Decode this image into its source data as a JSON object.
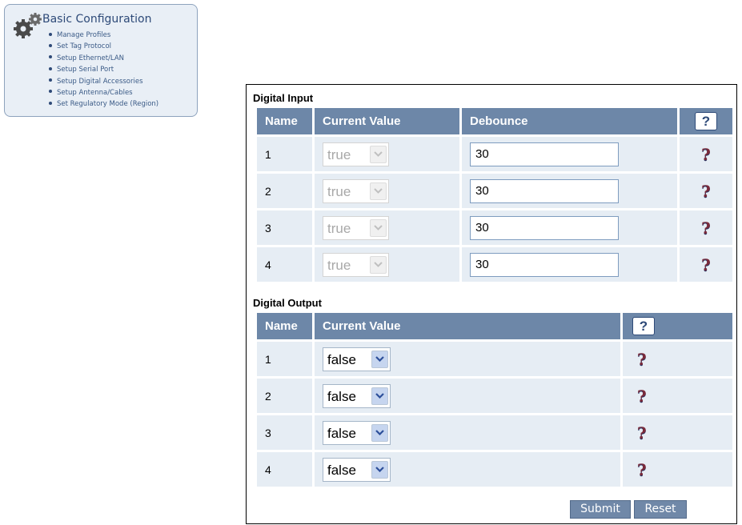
{
  "nav": {
    "title": "Basic Configuration",
    "items": [
      "Manage Profiles",
      "Set Tag Protocol",
      "Setup Ethernet/LAN",
      "Setup Serial Port",
      "Setup Digital Accessories",
      "Setup Antenna/Cables",
      "Set Regulatory Mode (Region)"
    ]
  },
  "digital_input": {
    "title": "Digital Input",
    "headers": {
      "name": "Name",
      "current_value": "Current Value",
      "debounce": "Debounce",
      "help": "?"
    },
    "rows": [
      {
        "name": "1",
        "value": "true",
        "debounce": "30",
        "help": "?"
      },
      {
        "name": "2",
        "value": "true",
        "debounce": "30",
        "help": "?"
      },
      {
        "name": "3",
        "value": "true",
        "debounce": "30",
        "help": "?"
      },
      {
        "name": "4",
        "value": "true",
        "debounce": "30",
        "help": "?"
      }
    ]
  },
  "digital_output": {
    "title": "Digital Output",
    "headers": {
      "name": "Name",
      "current_value": "Current Value",
      "help": "?"
    },
    "rows": [
      {
        "name": "1",
        "value": "false",
        "help": "?"
      },
      {
        "name": "2",
        "value": "false",
        "help": "?"
      },
      {
        "name": "3",
        "value": "false",
        "help": "?"
      },
      {
        "name": "4",
        "value": "false",
        "help": "?"
      }
    ]
  },
  "buttons": {
    "submit": "Submit",
    "reset": "Reset"
  },
  "colors": {
    "header_bg": "#6d87a8",
    "cell_bg": "#e6edf4",
    "panel_bg": "#e9eff6",
    "button_bg": "#7088a8"
  }
}
